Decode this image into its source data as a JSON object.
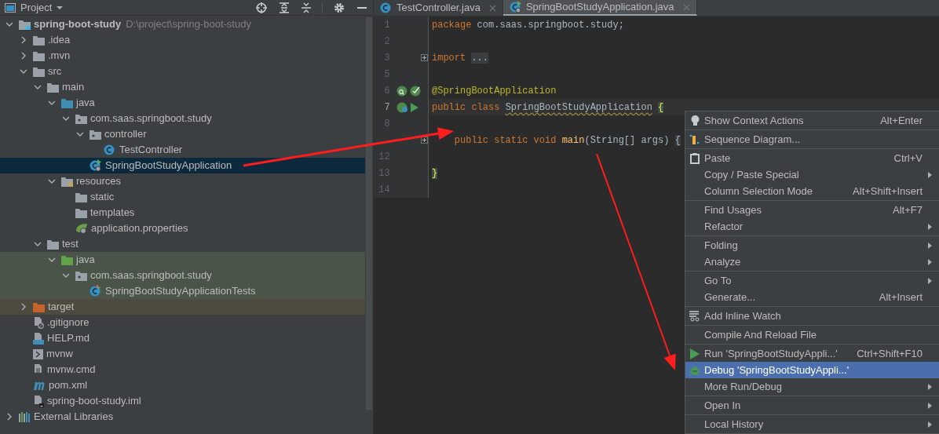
{
  "project_panel": {
    "title": "Project",
    "tree": [
      {
        "label": "spring-boot-study",
        "path": "D:\\project\\spring-boot-study",
        "kind": "module",
        "expanded": true,
        "selected": false,
        "children": [
          {
            "label": ".idea",
            "kind": "folder",
            "expanded": false,
            "selected": false
          },
          {
            "label": ".mvn",
            "kind": "folder",
            "expanded": false,
            "selected": false
          },
          {
            "label": "src",
            "kind": "folder",
            "expanded": true,
            "selected": false,
            "children": [
              {
                "label": "main",
                "kind": "folder",
                "expanded": true,
                "selected": false,
                "children": [
                  {
                    "label": "java",
                    "kind": "source-folder",
                    "expanded": true,
                    "selected": false,
                    "children": [
                      {
                        "label": "com.saas.springboot.study",
                        "kind": "package",
                        "expanded": true,
                        "selected": false,
                        "children": [
                          {
                            "label": "controller",
                            "kind": "package",
                            "expanded": true,
                            "selected": false,
                            "children": [
                              {
                                "label": "TestController",
                                "kind": "class",
                                "selected": false
                              }
                            ]
                          },
                          {
                            "label": "SpringBootStudyApplication",
                            "kind": "spring-class",
                            "selected": true
                          }
                        ]
                      }
                    ]
                  },
                  {
                    "label": "resources",
                    "kind": "resources-folder",
                    "expanded": true,
                    "selected": false,
                    "children": [
                      {
                        "label": "static",
                        "kind": "folder",
                        "selected": false
                      },
                      {
                        "label": "templates",
                        "kind": "folder",
                        "selected": false
                      },
                      {
                        "label": "application.properties",
                        "kind": "properties",
                        "selected": false
                      }
                    ]
                  }
                ]
              },
              {
                "label": "test",
                "kind": "folder",
                "expanded": true,
                "selected": false,
                "children": [
                  {
                    "label": "java",
                    "kind": "test-folder",
                    "expanded": true,
                    "selected": false,
                    "color": "#4a5449",
                    "children": [
                      {
                        "label": "com.saas.springboot.study",
                        "kind": "package",
                        "expanded": true,
                        "selected": false,
                        "color": "#4a5449",
                        "children": [
                          {
                            "label": "SpringBootStudyApplicationTests",
                            "kind": "test-class",
                            "selected": false,
                            "color": "#4a5449"
                          }
                        ]
                      }
                    ]
                  }
                ]
              }
            ]
          },
          {
            "label": "target",
            "kind": "excluded-folder",
            "expanded": false,
            "selected": false,
            "color": "#4f4a3f"
          },
          {
            "label": ".gitignore",
            "kind": "ignore-file",
            "selected": false
          },
          {
            "label": "HELP.md",
            "kind": "markdown",
            "selected": false
          },
          {
            "label": "mvnw",
            "kind": "shell",
            "selected": false
          },
          {
            "label": "mvnw.cmd",
            "kind": "text-file",
            "selected": false
          },
          {
            "label": "pom.xml",
            "kind": "maven",
            "selected": false
          },
          {
            "label": "spring-boot-study.iml",
            "kind": "module-file",
            "selected": false
          }
        ]
      },
      {
        "label": "External Libraries",
        "kind": "libraries",
        "expanded": false,
        "selected": false
      }
    ]
  },
  "editor": {
    "tabs": [
      {
        "label": "TestController.java",
        "kind": "class",
        "selected": false
      },
      {
        "label": "SpringBootStudyApplication.java",
        "kind": "spring-class",
        "selected": true
      }
    ],
    "lines": [
      {
        "number": "1",
        "current": false,
        "fold": false,
        "tokens": [
          {
            "text": "package",
            "kind": "keyword"
          },
          {
            "text": " com.saas.springboot.study;",
            "kind": "plain"
          }
        ]
      },
      {
        "number": "2",
        "current": false,
        "fold": false
      },
      {
        "number": "3",
        "current": false,
        "fold": true,
        "tokens": [
          {
            "text": "import ",
            "kind": "keyword"
          },
          {
            "text": "...",
            "kind": "folded"
          }
        ]
      },
      {
        "number": "5",
        "current": false,
        "fold": false
      },
      {
        "number": "6",
        "current": false,
        "fold": false,
        "gutter": [
          {
            "kind": "spring-search"
          },
          {
            "kind": "spring-check"
          }
        ],
        "tokens": [
          {
            "text": "@SpringBootApplication",
            "kind": "annotation"
          }
        ]
      },
      {
        "number": "7",
        "current": true,
        "fold": false,
        "gutter": [
          {
            "kind": "spring-app"
          },
          {
            "kind": "run"
          }
        ],
        "tokens": [
          {
            "text": "public class ",
            "kind": "keyword"
          },
          {
            "text": "SpringBootStudyApplication",
            "kind": "warning"
          },
          {
            "text": "{",
            "kind": "spaced-brace"
          }
        ]
      },
      {
        "number": "8",
        "current": false,
        "fold": false
      },
      {
        "current": false,
        "fold": true,
        "tokens": [
          {
            "text": "    public static void ",
            "kind": "keyword"
          },
          {
            "text": "main",
            "kind": "method"
          },
          {
            "text": "(String[] args) ",
            "kind": "plain"
          },
          {
            "text": "{",
            "kind": "folded"
          }
        ]
      },
      {
        "number": "12",
        "current": false,
        "fold": false
      },
      {
        "number": "13",
        "current": false,
        "fold": false,
        "tokens": [
          {
            "text": "}",
            "kind": "brace"
          }
        ]
      },
      {
        "number": "14",
        "current": false,
        "fold": false
      }
    ]
  },
  "context_menu": {
    "groups": [
      [
        {
          "label": "Show Context Actions",
          "shortcut": "Alt+Enter",
          "kind": "bulb",
          "selected": false
        }
      ],
      [
        {
          "label": "Sequence Diagram...",
          "kind": "diagram",
          "selected": false
        }
      ],
      [
        {
          "label": "Paste",
          "shortcut": "Ctrl+V",
          "kind": "paste",
          "selected": false
        },
        {
          "label": "Copy / Paste Special",
          "submenu": true,
          "kind": "plain",
          "selected": false
        },
        {
          "label": "Column Selection Mode",
          "shortcut": "Alt+Shift+Insert",
          "kind": "plain",
          "selected": false
        }
      ],
      [
        {
          "label": "Find Usages",
          "shortcut": "Alt+F7",
          "kind": "plain",
          "selected": false
        },
        {
          "label": "Refactor",
          "submenu": true,
          "kind": "plain",
          "selected": false
        }
      ],
      [
        {
          "label": "Folding",
          "submenu": true,
          "kind": "plain",
          "selected": false
        },
        {
          "label": "Analyze",
          "submenu": true,
          "kind": "plain",
          "selected": false
        }
      ],
      [
        {
          "label": "Go To",
          "submenu": true,
          "kind": "plain",
          "selected": false
        },
        {
          "label": "Generate...",
          "shortcut": "Alt+Insert",
          "kind": "plain",
          "selected": false
        }
      ],
      [
        {
          "label": "Add Inline Watch",
          "kind": "watch",
          "selected": false
        }
      ],
      [
        {
          "label": "Compile And Reload File",
          "kind": "plain",
          "selected": false
        }
      ],
      [
        {
          "label": "Run 'SpringBootStudyAppli...'",
          "shortcut": "Ctrl+Shift+F10",
          "kind": "run",
          "selected": false
        },
        {
          "label": "Debug 'SpringBootStudyAppli...'",
          "kind": "debug",
          "selected": true
        },
        {
          "label": "More Run/Debug",
          "submenu": true,
          "kind": "plain",
          "selected": false
        }
      ],
      [
        {
          "label": "Open In",
          "submenu": true,
          "kind": "plain",
          "selected": false
        }
      ],
      [
        {
          "label": "Local History",
          "submenu": true,
          "kind": "plain",
          "selected": false
        }
      ]
    ]
  }
}
